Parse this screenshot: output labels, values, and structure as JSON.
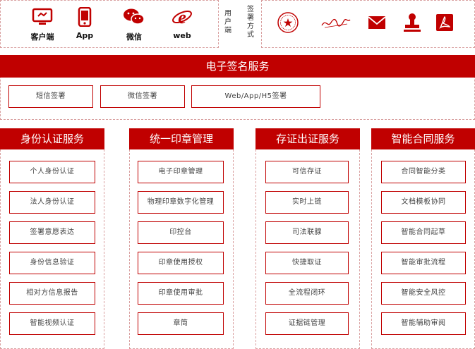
{
  "clients": [
    {
      "label": "客户端",
      "icon": "monitor-icon"
    },
    {
      "label": "App",
      "icon": "phone-icon"
    },
    {
      "label": "微信",
      "icon": "wechat-icon"
    },
    {
      "label": "web",
      "icon": "ie-browser-icon"
    }
  ],
  "user_end_label": "用户端",
  "sign_method_label": "签署方式",
  "sign_methods": [
    {
      "icon": "seal-stamp-icon"
    },
    {
      "icon": "handwritten-signature-icon"
    },
    {
      "icon": "email-icon"
    },
    {
      "icon": "stamp-icon"
    },
    {
      "icon": "pdf-icon"
    }
  ],
  "esign": {
    "title": "电子签名服务",
    "items": [
      "短信签署",
      "微信签署",
      "Web/App/H5签署"
    ]
  },
  "services": [
    {
      "title": "身份认证服务",
      "items": [
        "个人身份认证",
        "法人身份认证",
        "签署意愿表达",
        "身份信息验证",
        "相对方信息报告",
        "智能视频认证"
      ]
    },
    {
      "title": "统一印章管理",
      "items": [
        "电子印章管理",
        "物理印章数字化管理",
        "印控台",
        "印章使用授权",
        "印章使用审批",
        "章筒"
      ]
    },
    {
      "title": "存证出证服务",
      "items": [
        "可信存证",
        "实时上链",
        "司法联腺",
        "快捷取证",
        "全流程闭环",
        "证据链管理"
      ]
    },
    {
      "title": "智能合同服务",
      "items": [
        "合同智能分类",
        "文档模板协同",
        "智能合同起草",
        "智能审批流程",
        "智能安全风控",
        "智能辅助审阅"
      ]
    }
  ],
  "colors": {
    "accent": "#c00000",
    "dashed_border": "#d9a0a0"
  }
}
